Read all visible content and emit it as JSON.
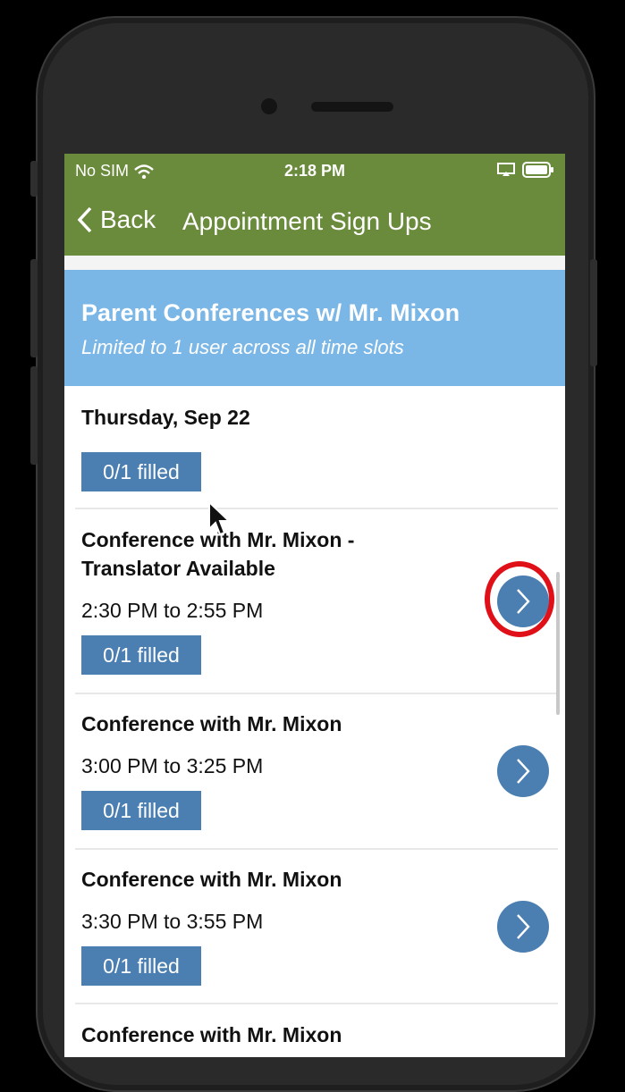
{
  "status": {
    "carrier": "No SIM",
    "time": "2:18 PM"
  },
  "nav": {
    "back_label": "Back",
    "title": "Appointment Sign Ups"
  },
  "banner": {
    "title": "Parent Conferences w/ Mr. Mixon",
    "subtitle": "Limited to 1 user across all time slots"
  },
  "day": {
    "label": "Thursday, Sep 22",
    "filled": "0/1 filled"
  },
  "slots": [
    {
      "title_line1": "Conference with Mr. Mixon -",
      "title_line2": "Translator Available",
      "time": "2:30 PM to 2:55 PM",
      "filled": "0/1 filled"
    },
    {
      "title_line1": "Conference with Mr. Mixon",
      "time": "3:00 PM to 3:25 PM",
      "filled": "0/1 filled"
    },
    {
      "title_line1": "Conference with Mr. Mixon",
      "time": "3:30 PM to 3:55 PM",
      "filled": "0/1 filled"
    },
    {
      "title_line1": "Conference with Mr. Mixon"
    }
  ],
  "icons": {
    "wifi": "wifi-icon",
    "cast": "screen-mirror-icon",
    "battery": "battery-icon",
    "back": "chevron-left-icon",
    "arrow": "chevron-right-icon"
  },
  "colors": {
    "nav_green": "#6a8a3c",
    "banner_blue": "#7ab6e6",
    "badge_blue": "#4b7fb1",
    "highlight_red": "#e01018"
  }
}
